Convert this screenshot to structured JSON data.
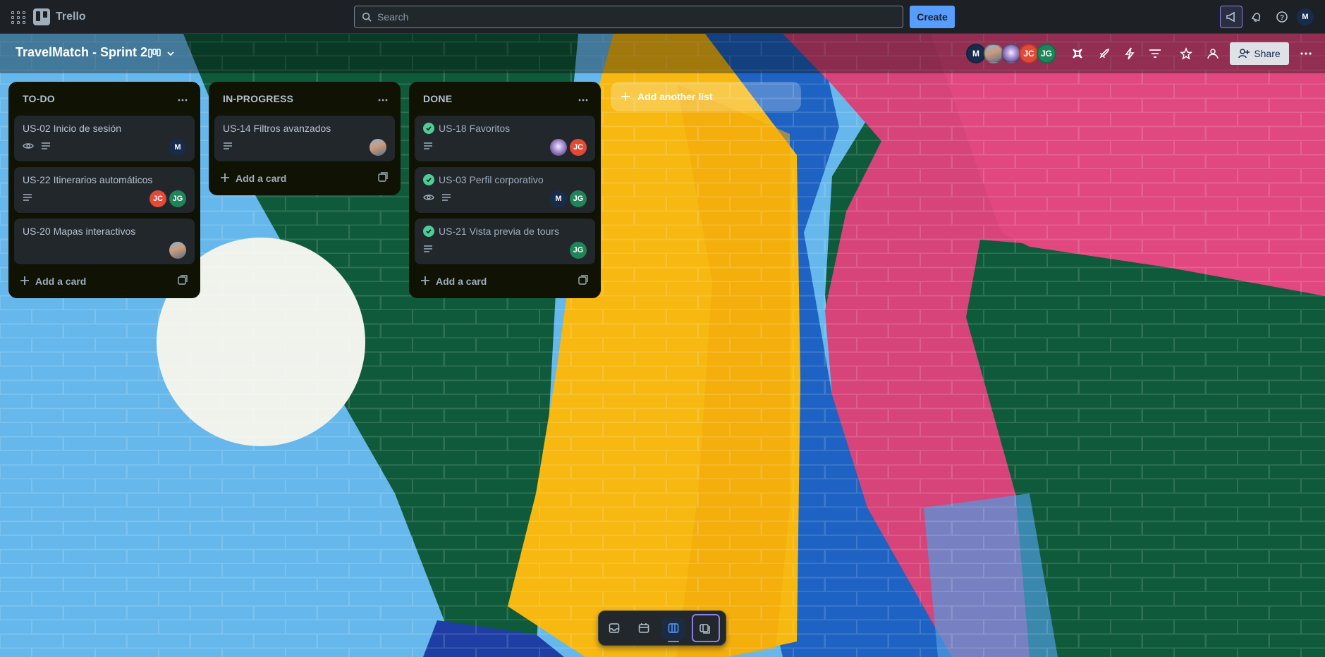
{
  "app": {
    "name": "Trello",
    "search_placeholder": "Search",
    "create_label": "Create",
    "user_initial": "M"
  },
  "board": {
    "title": "TravelMatch - Sprint 2",
    "share_label": "Share",
    "members": [
      {
        "initials": "M",
        "color": "#172b4d"
      },
      {
        "initials": "",
        "color": "#6b778c",
        "kind": "photo"
      },
      {
        "initials": "",
        "color": "#8777d9",
        "kind": "photo"
      },
      {
        "initials": "JC",
        "color": "#e34935"
      },
      {
        "initials": "JG",
        "color": "#1f845a"
      }
    ]
  },
  "lists": [
    {
      "title": "TO-DO",
      "add_card_label": "Add a card",
      "cards": [
        {
          "title": "US-02 Inicio de sesión",
          "watch": true,
          "description": true,
          "done": false,
          "members": [
            {
              "initials": "M",
              "color": "#172b4d"
            }
          ]
        },
        {
          "title": "US-22 Itinerarios automáticos",
          "watch": false,
          "description": true,
          "done": false,
          "members": [
            {
              "initials": "JC",
              "color": "#e34935"
            },
            {
              "initials": "JG",
              "color": "#1f845a"
            }
          ]
        },
        {
          "title": "US-20 Mapas interactivos",
          "watch": false,
          "description": false,
          "done": false,
          "members": [
            {
              "initials": "",
              "color": "#6b778c",
              "kind": "photo"
            }
          ]
        }
      ]
    },
    {
      "title": "IN-PROGRESS",
      "add_card_label": "Add a card",
      "cards": [
        {
          "title": "US-14 Filtros avanzados",
          "watch": false,
          "description": true,
          "done": false,
          "members": [
            {
              "initials": "",
              "color": "#6b778c",
              "kind": "photo"
            }
          ]
        }
      ]
    },
    {
      "title": "DONE",
      "add_card_label": "Add a card",
      "cards": [
        {
          "title": "US-18 Favoritos",
          "watch": false,
          "description": true,
          "done": true,
          "members": [
            {
              "initials": "",
              "color": "#8777d9",
              "kind": "photo"
            },
            {
              "initials": "JC",
              "color": "#e34935"
            }
          ]
        },
        {
          "title": "US-03 Perfil corporativo",
          "watch": true,
          "description": true,
          "done": true,
          "members": [
            {
              "initials": "M",
              "color": "#172b4d"
            },
            {
              "initials": "JG",
              "color": "#1f845a"
            }
          ]
        },
        {
          "title": "US-21 Vista previa de tours",
          "watch": false,
          "description": true,
          "done": true,
          "members": [
            {
              "initials": "JG",
              "color": "#1f845a"
            }
          ]
        }
      ]
    }
  ],
  "add_list_label": "Add another list",
  "bottom_switcher": [
    "inbox-icon",
    "planner-icon",
    "board-icon",
    "switch-boards-icon"
  ]
}
